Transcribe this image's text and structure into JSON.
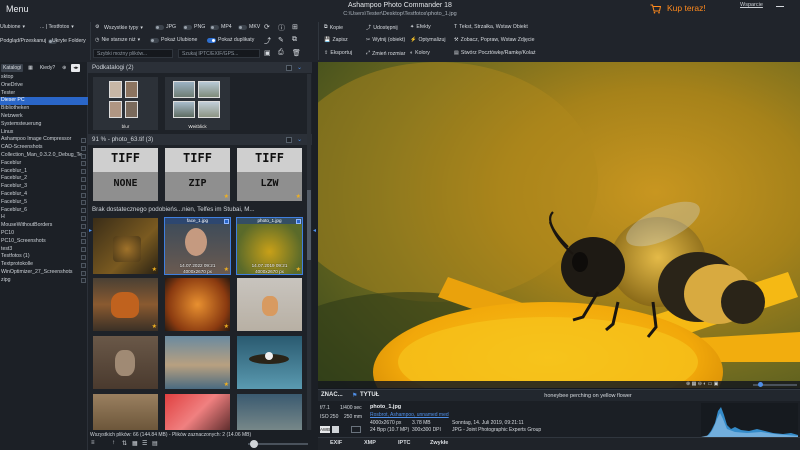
{
  "window": {
    "menu": "Menu",
    "title": "Ashampoo Photo Commander 18",
    "path": "C:\\Users\\Tester\\Desktop\\Testfotos\\photo_1.jpg",
    "buy_now": "Kup teraz!",
    "help": "Wsparcie",
    "accent": "#2a66c8",
    "buy_color": "#ff8a1d"
  },
  "toolbar": {
    "favorites": "Ulubione",
    "testfotos": "... | Testfotos",
    "preview_toggle": "Podgląd/Przeskanuj",
    "hidden_folders": "Ukryte Foldery",
    "all_types": "Wszystkie typy",
    "jpg": "JPG",
    "png": "PNG",
    "mp4": "MP4",
    "mkv": "MKV",
    "not_older": "Nie starsze niż",
    "show_favorites": "Pokaż Ulubione",
    "show_duplicates": "Pokaż duplikaty",
    "quick_search_placeholder": "Szybki możny plików...",
    "iptc_search_placeholder": "Szukaj IPTC/EXIF/GPS...",
    "copy": "Kopie",
    "save": "Zapisz",
    "export": "Eksportuj",
    "share": "Udostępnij",
    "cut": "Wytnij (obiekt)",
    "resize": "Zmień rozmiar",
    "effects": "Efekty",
    "optimize": "Optymalizuj",
    "colors": "Kolory",
    "text_arrow": "Tekst, Strzałka, Wstaw Obiekt",
    "show_fix": "Zobacz, Popraw, Wstaw Zdjęcie",
    "create_postcard": "Stwórz Pocztówkę/Ramkę/Kolaż"
  },
  "left_panel": {
    "tab_catalogs": "Katalogi",
    "tab_when": "Kiedy?",
    "tree": [
      {
        "label": "sktop",
        "selected": false,
        "check": false
      },
      {
        "label": "OneDrive",
        "selected": false,
        "check": false
      },
      {
        "label": "Tester",
        "selected": false,
        "check": false
      },
      {
        "label": "Dieser PC",
        "selected": true,
        "check": false
      },
      {
        "label": "Bibliotheken",
        "selected": false,
        "check": false
      },
      {
        "label": "Netzwerk",
        "selected": false,
        "check": false
      },
      {
        "label": "Systemsteuerung",
        "selected": false,
        "check": false
      },
      {
        "label": "Linux",
        "selected": false,
        "check": false
      },
      {
        "label": "Ashampoo Image Compressor",
        "selected": false,
        "check": true
      },
      {
        "label": "CAD-Screenshots",
        "selected": false,
        "check": true
      },
      {
        "label": "Collection_Man_0.3.2.0_Debug_Te...",
        "selected": false,
        "check": true
      },
      {
        "label": "Faceblur",
        "selected": false,
        "check": true
      },
      {
        "label": "Faceblur_1",
        "selected": false,
        "check": true
      },
      {
        "label": "Faceblur_2",
        "selected": false,
        "check": true
      },
      {
        "label": "Faceblur_3",
        "selected": false,
        "check": true
      },
      {
        "label": "Faceblur_4",
        "selected": false,
        "check": true
      },
      {
        "label": "Faceblur_5",
        "selected": false,
        "check": true
      },
      {
        "label": "Faceblur_6",
        "selected": false,
        "check": true
      },
      {
        "label": "H",
        "selected": false,
        "check": true
      },
      {
        "label": "MouseWithoutBorders",
        "selected": false,
        "check": true
      },
      {
        "label": "PC10",
        "selected": false,
        "check": true
      },
      {
        "label": "PC10_Screenshots",
        "selected": false,
        "check": true
      },
      {
        "label": "test3",
        "selected": false,
        "check": true
      },
      {
        "label": "Testfotos (1)",
        "selected": false,
        "check": true
      },
      {
        "label": "Textprotokolle",
        "selected": false,
        "check": true
      },
      {
        "label": "WinOptimizer_27_Screenshots",
        "selected": false,
        "check": true
      },
      {
        "label": "zipg",
        "selected": false,
        "check": true
      }
    ]
  },
  "middle": {
    "subfolders_header": "Podkatalogi  (2)",
    "subfolders": [
      {
        "label": "blur"
      },
      {
        "label": "Weitblick"
      }
    ],
    "group1_header": "91 % - photo_63.tif  (3)",
    "tiff_words": [
      "NONE",
      "ZIP",
      "LZW"
    ],
    "group2_header": "Brak dostatecznego podobieńs...nien, Telfes im Stubai, M...",
    "selected_caps": [
      {
        "name": "face_1.jpg",
        "info": "14.07.2022 09:21\n4000x2670 px"
      },
      {
        "name": "photo_1.jpg",
        "info": "14.07.2019 09:21\n4000x2670 px"
      }
    ],
    "status": "Wszystkich plików: 66 (144.84 MB) - Plików zaznaczonych: 2 (14.06 MB)"
  },
  "preview": {
    "caption": "honeybee perching on yellow flower"
  },
  "metadata": {
    "tab_tags": "ZNAC...",
    "tab_title": "TYTUŁ",
    "aperture": "f/7.1",
    "shutter": "1/400 sec",
    "iso": "ISO 250",
    "focal": "250 mm",
    "filename": "photo_1.jpg",
    "people": "Rosbrot, Ashampoo, unnamed med",
    "dimensions": "4000x2670 px",
    "size": "3.78 MB",
    "date": "Sonntag, 14. Juli 2019, 09:21:11",
    "bpp": "24 Bpp (10.7 MP)",
    "dpi": "300x300 DPI",
    "format": "JPG - Joint Photographic Experts Group",
    "tabs": [
      "EXIF",
      "XMP",
      "IPTC",
      "Zwykłe"
    ]
  }
}
